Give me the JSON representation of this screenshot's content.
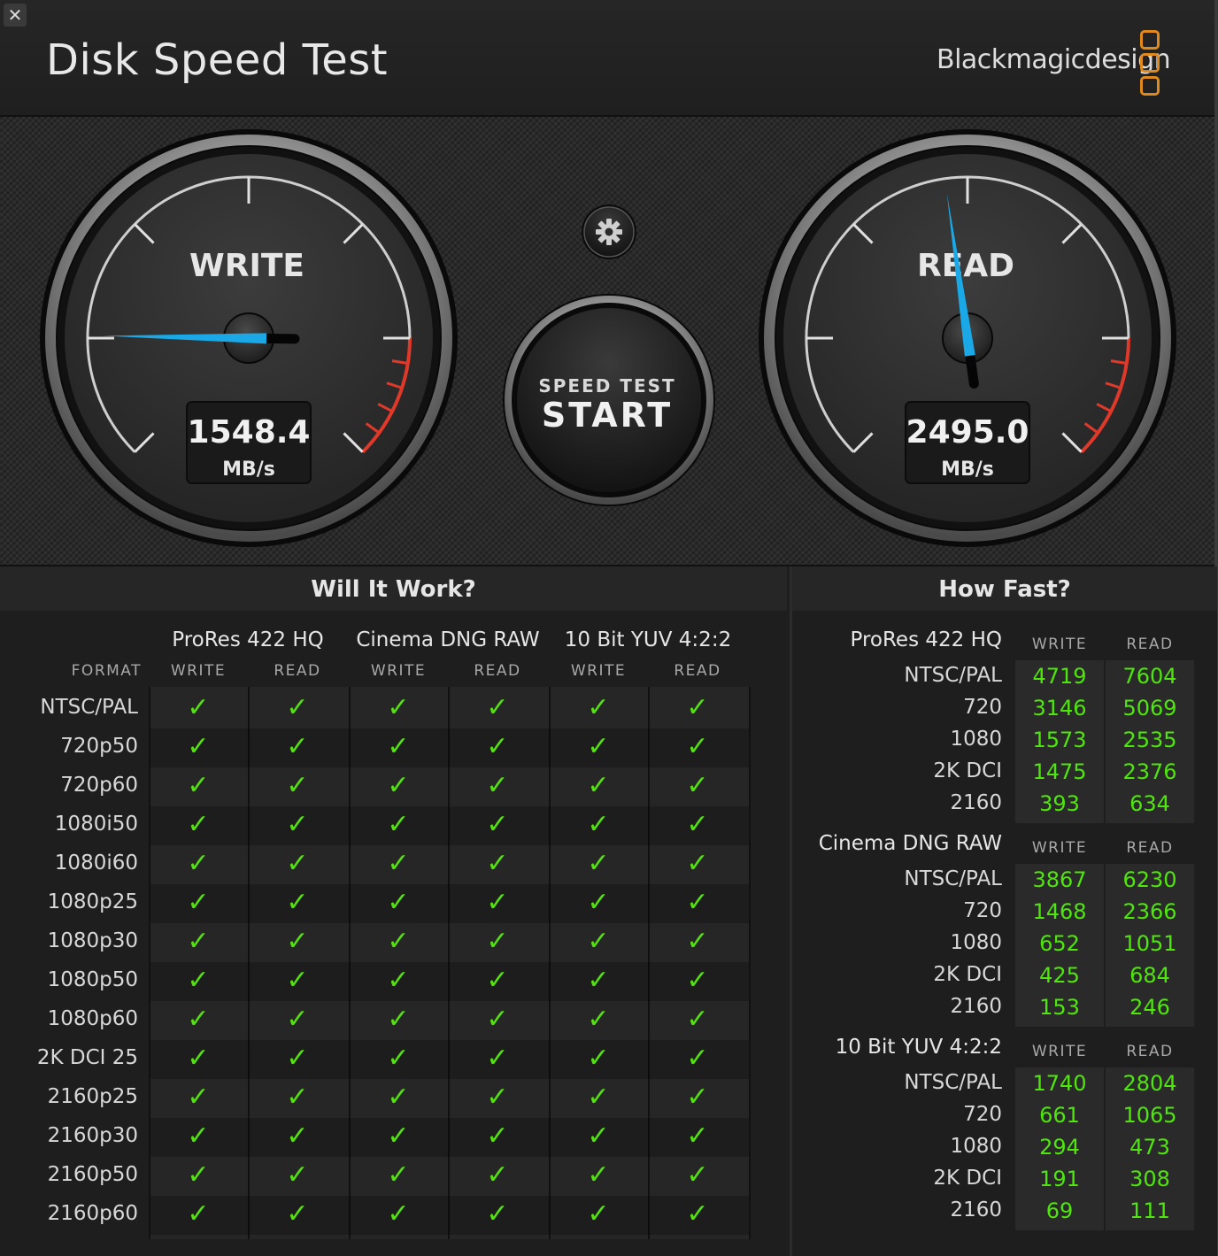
{
  "app": {
    "title": "Disk Speed Test",
    "brand": "Blackmagicdesign",
    "close_icon": "close-icon"
  },
  "gauges": {
    "write": {
      "label": "WRITE",
      "value": "1548.4",
      "unit": "MB/s",
      "needle_fraction": 0.17
    },
    "read": {
      "label": "READ",
      "value": "2495.0",
      "unit": "MB/s",
      "needle_fraction": 0.47
    }
  },
  "start_button": {
    "top": "SPEED TEST",
    "main": "START"
  },
  "settings_icon": "gear-icon",
  "will_it_work": {
    "title": "Will It Work?",
    "format_label": "FORMAT",
    "groups": [
      {
        "name": "ProRes 422 HQ",
        "write": "WRITE",
        "read": "READ"
      },
      {
        "name": "Cinema DNG RAW",
        "write": "WRITE",
        "read": "READ"
      },
      {
        "name": "10 Bit YUV 4:2:2",
        "write": "WRITE",
        "read": "READ"
      }
    ],
    "formats": [
      "NTSC/PAL",
      "720p50",
      "720p60",
      "1080i50",
      "1080i60",
      "1080p25",
      "1080p30",
      "1080p50",
      "1080p60",
      "2K DCI 25",
      "2160p25",
      "2160p30",
      "2160p50",
      "2160p60"
    ],
    "check_glyph": "✓"
  },
  "how_fast": {
    "title": "How Fast?",
    "sections": [
      {
        "name": "ProRes 422 HQ",
        "write_label": "WRITE",
        "read_label": "READ",
        "rows": [
          [
            "NTSC/PAL",
            "4719",
            "7604"
          ],
          [
            "720",
            "3146",
            "5069"
          ],
          [
            "1080",
            "1573",
            "2535"
          ],
          [
            "2K DCI",
            "1475",
            "2376"
          ],
          [
            "2160",
            "393",
            "634"
          ]
        ]
      },
      {
        "name": "Cinema DNG RAW",
        "write_label": "WRITE",
        "read_label": "READ",
        "rows": [
          [
            "NTSC/PAL",
            "3867",
            "6230"
          ],
          [
            "720",
            "1468",
            "2366"
          ],
          [
            "1080",
            "652",
            "1051"
          ],
          [
            "2K DCI",
            "425",
            "684"
          ],
          [
            "2160",
            "153",
            "246"
          ]
        ]
      },
      {
        "name": "10 Bit YUV 4:2:2",
        "write_label": "WRITE",
        "read_label": "READ",
        "rows": [
          [
            "NTSC/PAL",
            "1740",
            "2804"
          ],
          [
            "720",
            "661",
            "1065"
          ],
          [
            "1080",
            "294",
            "473"
          ],
          [
            "2K DCI",
            "191",
            "308"
          ],
          [
            "2160",
            "69",
            "111"
          ]
        ]
      }
    ]
  },
  "colors": {
    "needle": "#1aa9e6",
    "check": "#55e00f",
    "value_green": "#4ee60c",
    "redline": "#e0392a",
    "brand_orange": "#e08a1e"
  }
}
